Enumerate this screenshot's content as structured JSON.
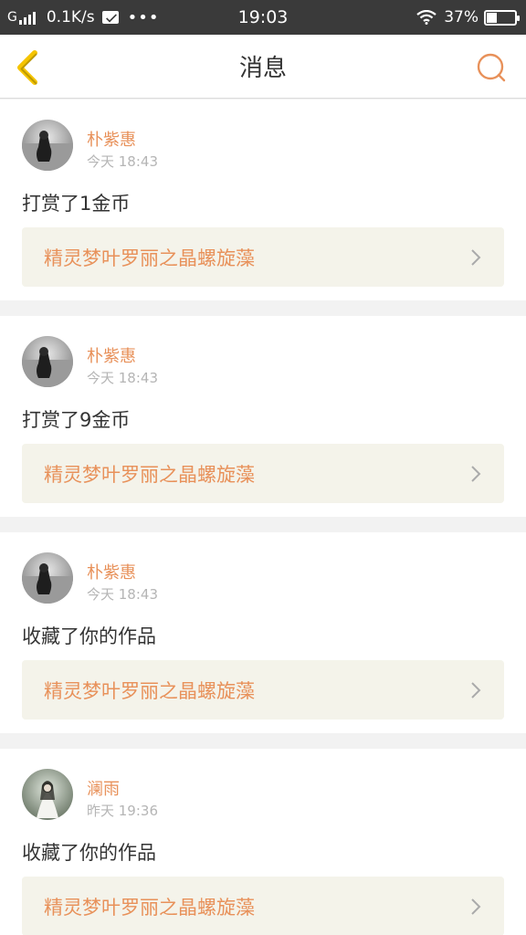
{
  "status_bar": {
    "carrier": "G",
    "speed": "0.1K/s",
    "dots": "•••",
    "time": "19:03",
    "battery": "37%"
  },
  "header": {
    "title": "消息",
    "back_icon": "chevron-left-icon",
    "search_icon": "search-icon"
  },
  "colors": {
    "accent": "#e8915a",
    "back_arrow": "#f5c400",
    "status_bar_bg": "#3a3a3a",
    "card_box_bg": "#f4f3ea"
  },
  "messages": [
    {
      "name": "朴紫惠",
      "time": "今天 18:43",
      "action": "打赏了1金币",
      "work": "精灵梦叶罗丽之晶螺旋藻"
    },
    {
      "name": "朴紫惠",
      "time": "今天 18:43",
      "action": "打赏了9金币",
      "work": "精灵梦叶罗丽之晶螺旋藻"
    },
    {
      "name": "朴紫惠",
      "time": "今天 18:43",
      "action": "收藏了你的作品",
      "work": "精灵梦叶罗丽之晶螺旋藻"
    },
    {
      "name": "澜雨",
      "time": "昨天 19:36",
      "action": "收藏了你的作品",
      "work": "精灵梦叶罗丽之晶螺旋藻"
    }
  ]
}
